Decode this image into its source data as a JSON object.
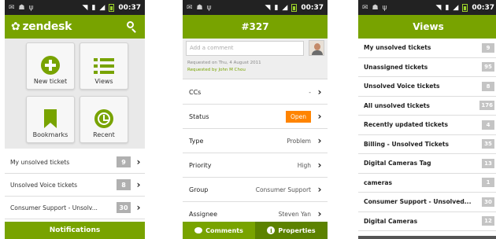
{
  "status_bar": {
    "time": "00:37",
    "left_icons": [
      "mail-icon",
      "android-icon",
      "usb-icon"
    ],
    "right_icons": [
      "wifi-icon",
      "vibrate-icon",
      "signal-icon",
      "battery-icon"
    ]
  },
  "colors": {
    "brand_green": "#78a300",
    "active_tab": "#5c8200",
    "status_orange": "#ff8400",
    "count_gray": "#b0b0b0"
  },
  "screen1": {
    "logo_text": "zendesk",
    "tiles": [
      {
        "label": "New ticket",
        "icon": "plus-icon"
      },
      {
        "label": "Views",
        "icon": "list-icon"
      },
      {
        "label": "Bookmarks",
        "icon": "bookmark-icon"
      },
      {
        "label": "Recent",
        "icon": "clock-icon"
      }
    ],
    "items": [
      {
        "label": "My unsolved tickets",
        "count": "9"
      },
      {
        "label": "Unsolved Voice tickets",
        "count": "8"
      },
      {
        "label": "Consumer Support - Unsolv...",
        "count": "30"
      }
    ],
    "bottom_label": "Notifications"
  },
  "screen2": {
    "title": "#327",
    "comment_placeholder": "Add a comment",
    "requested_on": "Requested on Thu, 4 August 2011",
    "requested_by": "Requested by John M Chou",
    "props": [
      {
        "label": "CCs",
        "value": "-"
      },
      {
        "label": "Status",
        "value": "Open"
      },
      {
        "label": "Type",
        "value": "Problem"
      },
      {
        "label": "Priority",
        "value": "High"
      },
      {
        "label": "Group",
        "value": "Consumer Support"
      },
      {
        "label": "Assignee",
        "value": "Steven Yan"
      }
    ],
    "tabs": [
      {
        "label": "Comments"
      },
      {
        "label": "Properties"
      }
    ]
  },
  "screen3": {
    "title": "Views",
    "views": [
      {
        "label": "My unsolved tickets",
        "count": "9"
      },
      {
        "label": "Unassigned tickets",
        "count": "95"
      },
      {
        "label": "Unsolved Voice tickets",
        "count": "8"
      },
      {
        "label": "All unsolved tickets",
        "count": "176"
      },
      {
        "label": "Recently updated tickets",
        "count": "4"
      },
      {
        "label": "Billing - Unsolved Tickets",
        "count": "35"
      },
      {
        "label": "Digital Cameras Tag",
        "count": "13"
      },
      {
        "label": "cameras",
        "count": "1"
      },
      {
        "label": "Consumer Support - Unsolved...",
        "count": "30"
      },
      {
        "label": "Digital Cameras",
        "count": "12"
      }
    ]
  }
}
